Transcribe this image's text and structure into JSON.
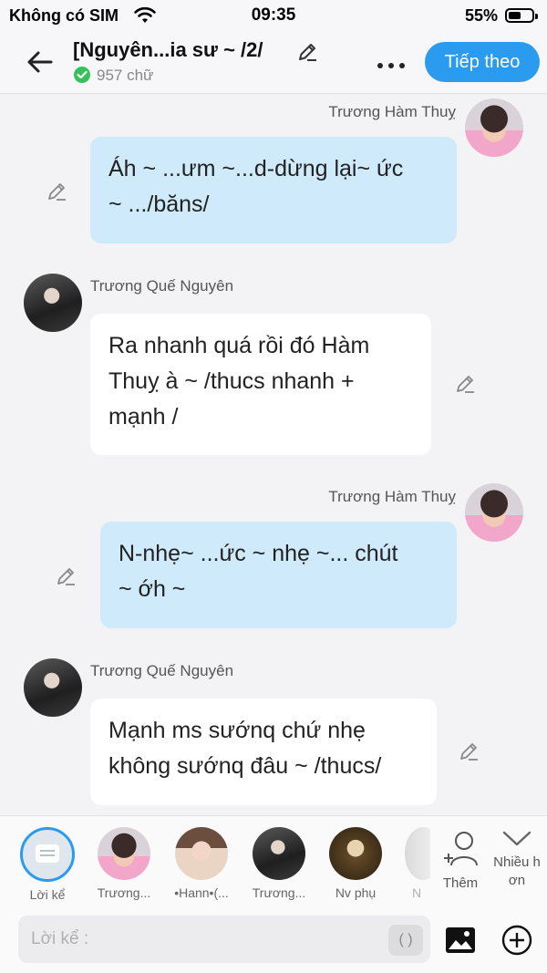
{
  "status_bar": {
    "carrier": "Không có SIM",
    "time": "09:35",
    "battery": "55%",
    "battery_level": 0.55
  },
  "header": {
    "title": "[Nguyên...ia sư ~ /2/",
    "word_count": "957 chữ",
    "next_button": "Tiếp theo"
  },
  "messages": [
    {
      "sender": "Trương Hàm Thuỵ",
      "side": "right",
      "lines": [
        "Áh ~ ...ưm ~...d-dừng lại~ ức",
        "~ .../băns/"
      ]
    },
    {
      "sender": "Trương Quế Nguyên",
      "side": "left",
      "lines": [
        "Ra nhanh quá rồi đó Hàm",
        "Thuỵ à ~ /thucs nhanh +",
        "mạnh /"
      ]
    },
    {
      "sender": "Trương Hàm Thuỵ",
      "side": "right",
      "lines": [
        "N-nhẹ~ ...ức ~ nhẹ ~... chút",
        "~ ớh ~"
      ]
    },
    {
      "sender": "Trương Quế Nguyên",
      "side": "left",
      "lines": [
        "Mạnh ms sướnq chứ nhẹ",
        "không sướnq đâu ~ /thucs/"
      ]
    }
  ],
  "characters": [
    {
      "label": "Lời kể"
    },
    {
      "label": "Trương..."
    },
    {
      "label": "•Hann•(..."
    },
    {
      "label": "Trương..."
    },
    {
      "label": "Nv phụ"
    },
    {
      "label": "N"
    }
  ],
  "strip_actions": {
    "add": "Thêm",
    "expand_line1": "Nhiều h",
    "expand_line2": "ơn"
  },
  "composer": {
    "placeholder": "Lời kể :",
    "paren_button": "( )"
  },
  "colors": {
    "accent": "#2b9bf0",
    "right_bubble": "#cfeafb",
    "left_bubble": "#ffffff",
    "check": "#35c25a"
  }
}
